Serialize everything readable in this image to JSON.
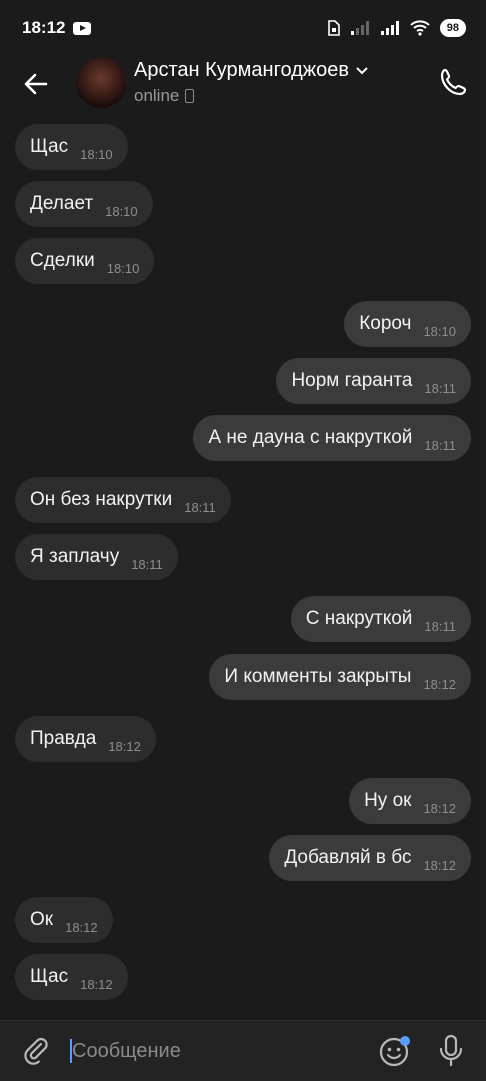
{
  "status_bar": {
    "time": "18:12",
    "battery": "98"
  },
  "header": {
    "contact_name": "Арстан Курмангоджоев",
    "status": "online"
  },
  "messages": [
    {
      "dir": "in",
      "text": "Щас",
      "time": "18:10"
    },
    {
      "dir": "in",
      "text": "Делает",
      "time": "18:10"
    },
    {
      "dir": "in",
      "text": "Сделки",
      "time": "18:10"
    },
    {
      "dir": "out",
      "text": "Короч",
      "time": "18:10"
    },
    {
      "dir": "out",
      "text": "Норм гаранта",
      "time": "18:11"
    },
    {
      "dir": "out",
      "text": "А не дауна с накруткой",
      "time": "18:11"
    },
    {
      "dir": "in",
      "text": "Он без накрутки",
      "time": "18:11"
    },
    {
      "dir": "in",
      "text": "Я заплачу",
      "time": "18:11"
    },
    {
      "dir": "out",
      "text": "С накруткой",
      "time": "18:11"
    },
    {
      "dir": "out",
      "text": "И комменты закрыты",
      "time": "18:12"
    },
    {
      "dir": "in",
      "text": "Правда",
      "time": "18:12"
    },
    {
      "dir": "out",
      "text": "Ну ок",
      "time": "18:12"
    },
    {
      "dir": "out",
      "text": "Добавляй в бс",
      "time": "18:12"
    },
    {
      "dir": "in",
      "text": "Ок",
      "time": "18:12"
    },
    {
      "dir": "in",
      "text": "Щас",
      "time": "18:12"
    }
  ],
  "composer": {
    "placeholder": "Сообщение"
  },
  "colors": {
    "background": "#1b1b1b",
    "bubble_in": "#2d2d2d",
    "bubble_out": "#3b3b3b",
    "accent": "#5b9cff"
  }
}
